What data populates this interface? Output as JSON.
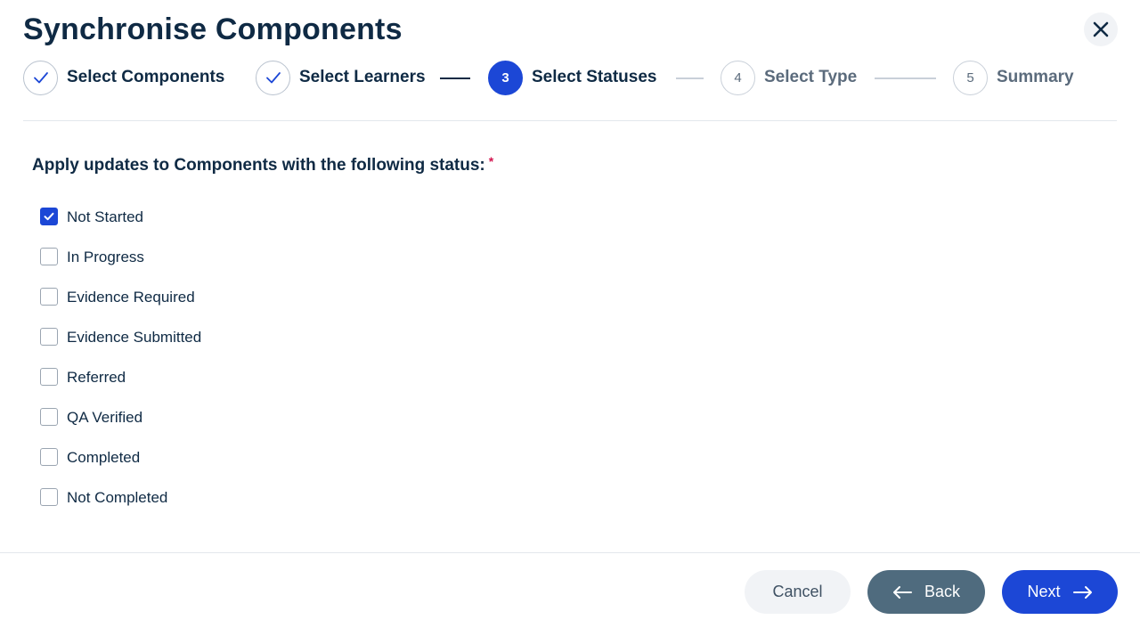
{
  "dialog": {
    "title": "Synchronise Components"
  },
  "stepper": {
    "steps": [
      {
        "number": "1",
        "label": "Select Components",
        "state": "done"
      },
      {
        "number": "2",
        "label": "Select Learners",
        "state": "done"
      },
      {
        "number": "3",
        "label": "Select Statuses",
        "state": "active"
      },
      {
        "number": "4",
        "label": "Select Type",
        "state": "pending"
      },
      {
        "number": "5",
        "label": "Summary",
        "state": "pending"
      }
    ]
  },
  "form": {
    "question": "Apply updates to Components with the following status:",
    "required_marker": "*",
    "options": [
      {
        "label": "Not Started",
        "checked": true
      },
      {
        "label": "In Progress",
        "checked": false
      },
      {
        "label": "Evidence Required",
        "checked": false
      },
      {
        "label": "Evidence Submitted",
        "checked": false
      },
      {
        "label": "Referred",
        "checked": false
      },
      {
        "label": "QA Verified",
        "checked": false
      },
      {
        "label": "Completed",
        "checked": false
      },
      {
        "label": "Not Completed",
        "checked": false
      }
    ]
  },
  "footer": {
    "cancel_label": "Cancel",
    "back_label": "Back",
    "next_label": "Next"
  },
  "icons": {
    "close": "close-icon",
    "check": "check-icon",
    "back": "arrow-left-icon",
    "next": "arrow-right-icon"
  },
  "colors": {
    "primary": "#1c47d6",
    "text": "#0f2a44",
    "muted": "#5b6b7c",
    "back_button": "#4f6b7e",
    "required": "#d3154f"
  }
}
